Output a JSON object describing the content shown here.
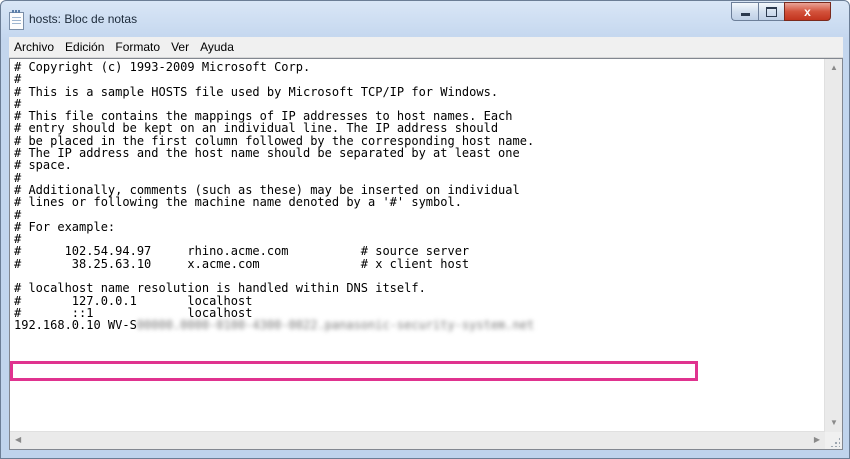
{
  "window": {
    "title": "hosts: Bloc de notas",
    "app_icon": "notepad-icon",
    "controls": {
      "minimize_icon": "minimize-icon",
      "maximize_icon": "maximize-icon",
      "close_icon": "close-icon",
      "close_glyph": "x"
    }
  },
  "menu": [
    "Archivo",
    "Edición",
    "Formato",
    "Ver",
    "Ayuda"
  ],
  "editor": {
    "lines": [
      "# Copyright (c) 1993-2009 Microsoft Corp.",
      "#",
      "# This is a sample HOSTS file used by Microsoft TCP/IP for Windows.",
      "#",
      "# This file contains the mappings of IP addresses to host names. Each",
      "# entry should be kept on an individual line. The IP address should",
      "# be placed in the first column followed by the corresponding host name.",
      "# The IP address and the host name should be separated by at least one",
      "# space.",
      "#",
      "# Additionally, comments (such as these) may be inserted on individual",
      "# lines or following the machine name denoted by a '#' symbol.",
      "#",
      "# For example:",
      "#",
      "#      102.54.94.97     rhino.acme.com          # source server",
      "#       38.25.63.10     x.acme.com              # x client host",
      "",
      "# localhost name resolution is handled within DNS itself.",
      "#       127.0.0.1       localhost",
      "#       ::1             localhost"
    ],
    "added_entry": {
      "visible_text": "192.168.0.10 WV-S",
      "redacted_text": "00000.0000-0100-4300-0022.panasonic-security-system.net"
    },
    "highlight_color": "#e0338f"
  },
  "scrollbars": {
    "up_icon": "scroll-up-arrow-icon",
    "down_icon": "scroll-down-arrow-icon",
    "left_icon": "scroll-left-arrow-icon",
    "right_icon": "scroll-right-arrow-icon",
    "grip_icon": "resize-grip-icon"
  }
}
